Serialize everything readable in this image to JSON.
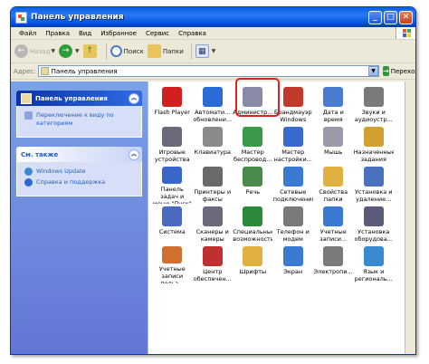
{
  "window": {
    "title": "Панель управления",
    "buttons": {
      "min": "_",
      "max": "□",
      "close": "✕"
    }
  },
  "menu": [
    "Файл",
    "Правка",
    "Вид",
    "Избранное",
    "Сервис",
    "Справка"
  ],
  "toolbar": {
    "back": "Назад",
    "search": "Поиск",
    "folders": "Папки"
  },
  "address": {
    "label": "Адрес:",
    "value": "Панель управления",
    "go": "Переход"
  },
  "left": {
    "panel1": {
      "title": "Панель управления",
      "links": [
        "Переключение к виду по категориям"
      ]
    },
    "panel2": {
      "title": "См. также",
      "links": [
        "Windows Update",
        "Справка и поддержка"
      ]
    }
  },
  "items": [
    {
      "label": "Flash Player",
      "icon": "flash-icon",
      "color": "#d21f1f"
    },
    {
      "label": "Автомати... обновлени...",
      "icon": "auto-update-icon",
      "color": "#2b6bd6"
    },
    {
      "label": "Администр...",
      "icon": "admin-tools-icon",
      "color": "#8a8aa8"
    },
    {
      "label": "Брандмауэр Windows",
      "icon": "firewall-icon",
      "color": "#c0392b"
    },
    {
      "label": "Дата и время",
      "icon": "clock-icon",
      "color": "#4a7bd0"
    },
    {
      "label": "Звуки и аудиоустр...",
      "icon": "speaker-icon",
      "color": "#7a7a7a"
    },
    {
      "label": "Игровые устройства",
      "icon": "gamepad-icon",
      "color": "#6a6a7a"
    },
    {
      "label": "Клавиатура",
      "icon": "keyboard-icon",
      "color": "#8a8a8a"
    },
    {
      "label": "Мастер беспровод...",
      "icon": "wireless-icon",
      "color": "#3a9a4a"
    },
    {
      "label": "Мастер настройки...",
      "icon": "network-wizard-icon",
      "color": "#3a6ad0"
    },
    {
      "label": "Мышь",
      "icon": "mouse-icon",
      "color": "#9a9aaa"
    },
    {
      "label": "Назначенные задания",
      "icon": "scheduled-tasks-icon",
      "color": "#d0a030"
    },
    {
      "label": "Панель задач и меню \"Пуск\"",
      "icon": "taskbar-icon",
      "color": "#3a66c8"
    },
    {
      "label": "Принтеры и факсы",
      "icon": "printer-icon",
      "color": "#6a6a6a"
    },
    {
      "label": "Речь",
      "icon": "speech-icon",
      "color": "#4a8a4a"
    },
    {
      "label": "Сетевые подключения",
      "icon": "network-connections-icon",
      "color": "#3a7ad0"
    },
    {
      "label": "Свойства папки",
      "icon": "folder-options-icon",
      "color": "#e0b040"
    },
    {
      "label": "Установка и удаление...",
      "icon": "add-remove-icon",
      "color": "#4a70c0"
    },
    {
      "label": "Система",
      "icon": "system-icon",
      "color": "#4a6ac0"
    },
    {
      "label": "Сканеры и камеры",
      "icon": "scanner-icon",
      "color": "#6a6a7a"
    },
    {
      "label": "Специальные возможности",
      "icon": "accessibility-icon",
      "color": "#2a8a3a"
    },
    {
      "label": "Телефон и модем",
      "icon": "phone-icon",
      "color": "#7a7a7a"
    },
    {
      "label": "Учетные записи...",
      "icon": "user-accounts-icon",
      "color": "#3a7ad0"
    },
    {
      "label": "Установка оборудова...",
      "icon": "hardware-icon",
      "color": "#5a5a7a"
    },
    {
      "label": "Учетные записи польз...",
      "icon": "users-icon",
      "color": "#d07030"
    },
    {
      "label": "Центр обеспечен...",
      "icon": "security-center-icon",
      "color": "#c03030"
    },
    {
      "label": "Шрифты",
      "icon": "fonts-icon",
      "color": "#e0b040"
    },
    {
      "label": "Экран",
      "icon": "display-icon",
      "color": "#3a7ad0"
    },
    {
      "label": "Электропи...",
      "icon": "power-icon",
      "color": "#7a7a7a"
    },
    {
      "label": "Язык и региональ...",
      "icon": "language-icon",
      "color": "#3a8ad0"
    }
  ]
}
